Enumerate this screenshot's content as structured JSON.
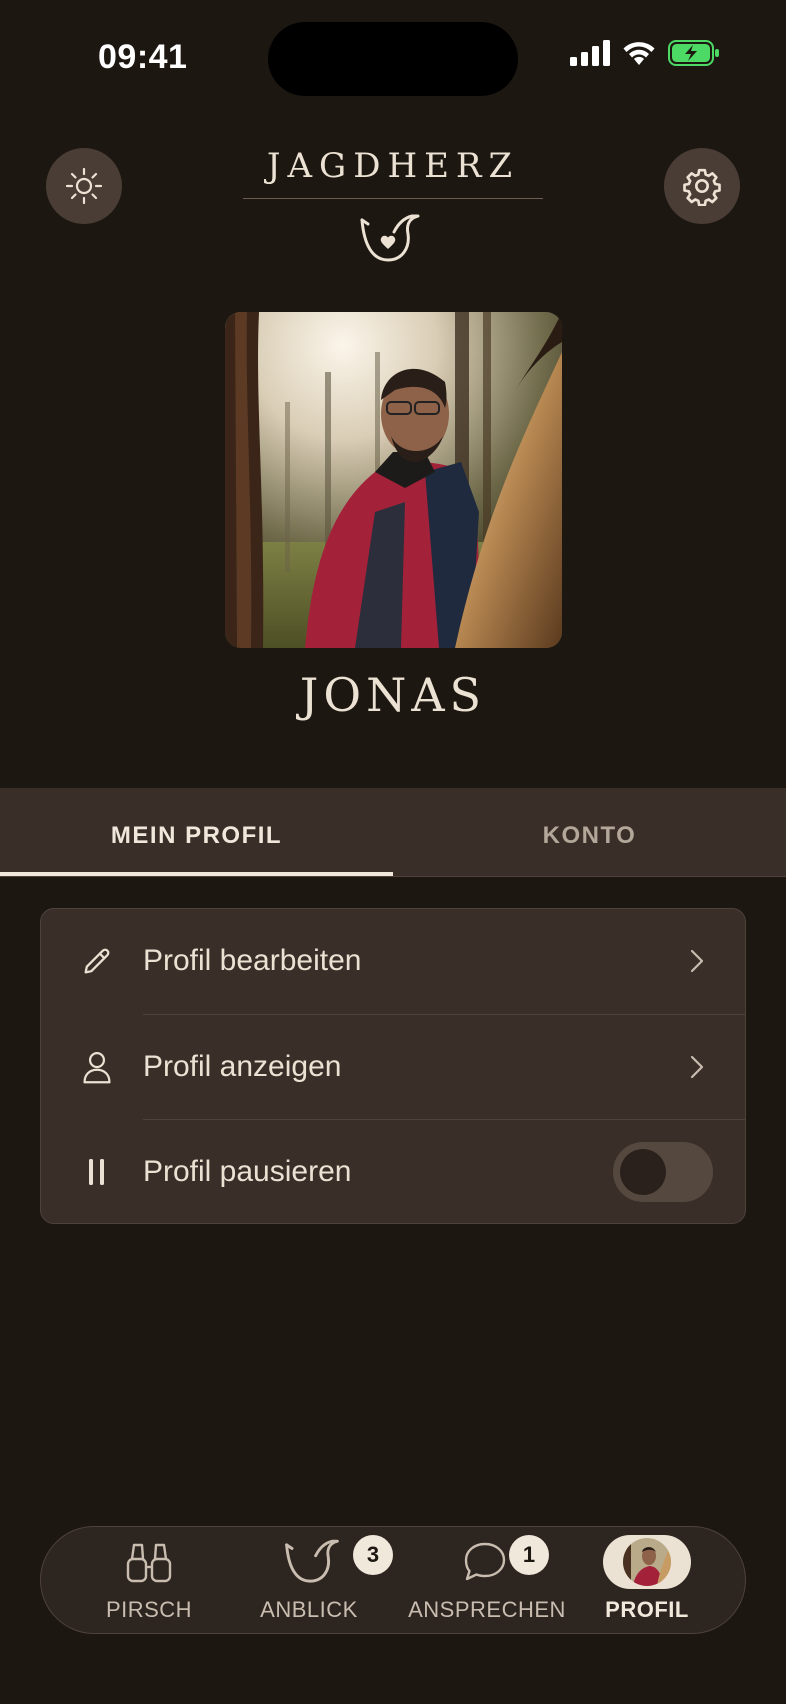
{
  "status_bar": {
    "time": "09:41"
  },
  "header": {
    "brand": "JAGDHERZ"
  },
  "profile": {
    "name": "JONAS"
  },
  "tabs": [
    {
      "label": "MEIN PROFIL",
      "active": true
    },
    {
      "label": "KONTO",
      "active": false
    }
  ],
  "menu": {
    "items": [
      {
        "label": "Profil bearbeiten",
        "icon": "pencil-icon"
      },
      {
        "label": "Profil anzeigen",
        "icon": "person-icon"
      },
      {
        "label": "Profil pausieren",
        "icon": "pause-icon",
        "toggle": false
      }
    ]
  },
  "nav": {
    "items": [
      {
        "label": "PIRSCH",
        "icon": "binoculars-icon"
      },
      {
        "label": "ANBLICK",
        "icon": "horn-icon",
        "badge": "3"
      },
      {
        "label": "ANSPRECHEN",
        "icon": "chat-bubble-icon",
        "badge": "1"
      },
      {
        "label": "PROFIL",
        "icon": "avatar",
        "active": true
      }
    ]
  },
  "colors": {
    "background": "#1d1712",
    "surface": "#3a2e29",
    "text": "#ece2d3",
    "muted": "#b3a79a",
    "battery": "#4cd964"
  }
}
